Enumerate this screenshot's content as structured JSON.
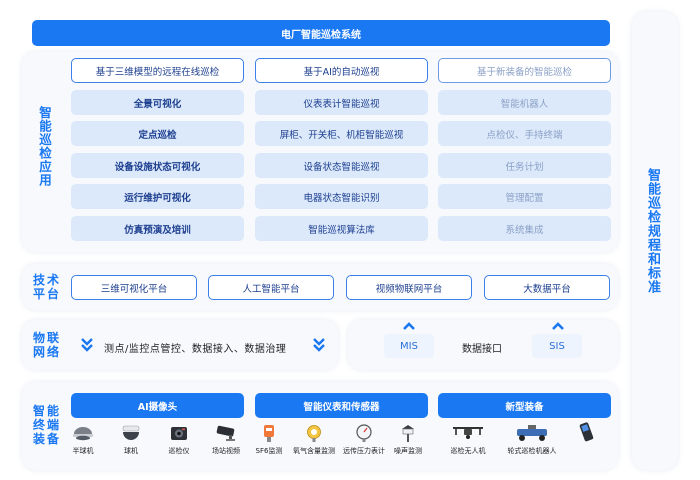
{
  "title": "电厂智能巡检系统",
  "right_label": "智能巡检规程和标准",
  "app": {
    "label": "智能巡检应用",
    "columns": [
      {
        "head": "基于三维模型的远程在线巡检",
        "items": [
          "全景可视化",
          "定点巡检",
          "设备设施状态可视化",
          "运行维护可视化",
          "仿真预演及培训"
        ]
      },
      {
        "head": "基于AI的自动巡视",
        "items": [
          "仪表表计智能巡视",
          "屏柜、开关柜、机柜智能巡视",
          "设备状态智能巡视",
          "电器状态智能识别",
          "智能巡视算法库"
        ]
      },
      {
        "head": "基于新装备的智能巡检",
        "items": [
          "智能机器人",
          "点检仪、手持终端",
          "任务计划",
          "管理配置",
          "系统集成"
        ]
      }
    ]
  },
  "tech": {
    "label": "技术平台",
    "items": [
      "三维可视化平台",
      "人工智能平台",
      "视频物联网平台",
      "大数据平台"
    ]
  },
  "iot": {
    "label": "物联网络",
    "left_text": "测点/监控点管控、数据接入、数据治理",
    "mis": "MIS",
    "interface": "数据接口",
    "sis": "SIS"
  },
  "terminal": {
    "label": "智能终端装备",
    "groups": [
      "AI摄像头",
      "智能仪表和传感器",
      "新型装备"
    ],
    "devices": [
      {
        "label": "半球机",
        "icon": "dome-camera-icon"
      },
      {
        "label": "球机",
        "icon": "ptz-camera-icon"
      },
      {
        "label": "巡检仪",
        "icon": "inspection-device-icon"
      },
      {
        "label": "场站视频",
        "icon": "bullet-camera-icon"
      },
      {
        "label": "SF6监测",
        "icon": "sf6-sensor-icon"
      },
      {
        "label": "氧气含量监测",
        "icon": "oxygen-sensor-icon"
      },
      {
        "label": "远传压力表计",
        "icon": "pressure-gauge-icon"
      },
      {
        "label": "噪声监测",
        "icon": "noise-monitor-icon"
      },
      {
        "label": "巡检无人机",
        "icon": "drone-icon"
      },
      {
        "label": "轮式巡检机器人",
        "icon": "wheeled-robot-icon"
      },
      {
        "label": "",
        "icon": "handheld-terminal-icon"
      }
    ]
  }
}
